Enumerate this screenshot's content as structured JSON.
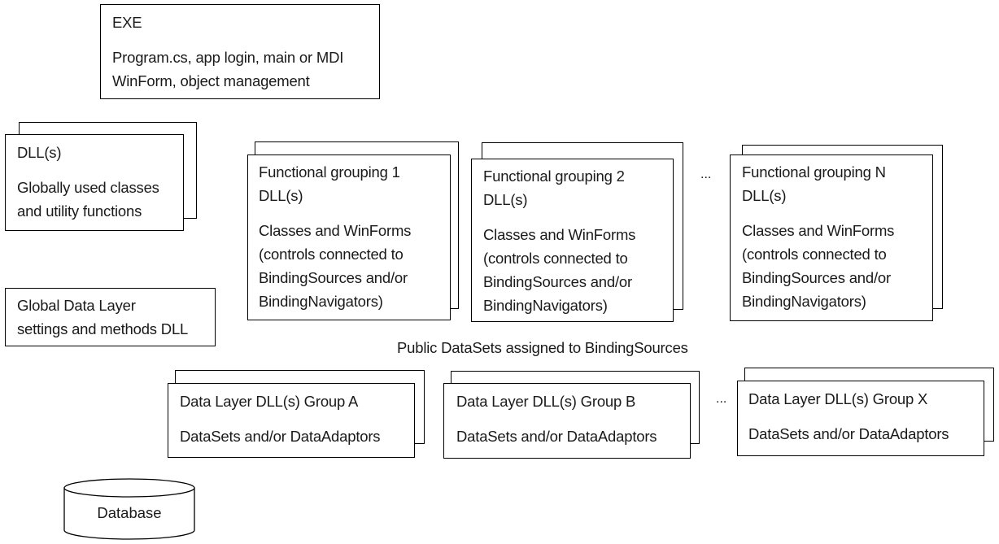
{
  "exe": {
    "title": "EXE",
    "lines": [
      "Program.cs, app login, main or MDI",
      "WinForm, object management"
    ]
  },
  "global_dll": {
    "title": "DLL(s)",
    "lines": [
      "Globally used classes",
      "and utility functions"
    ]
  },
  "global_data_layer": {
    "lines": [
      "Global Data Layer",
      "settings and methods DLL"
    ]
  },
  "functional_groups": [
    {
      "title_lines": [
        "Functional grouping 1",
        "DLL(s)"
      ],
      "lines": [
        "Classes and WinForms",
        "(controls connected to",
        "BindingSources and/or",
        "BindingNavigators)"
      ]
    },
    {
      "title_lines": [
        "Functional grouping 2",
        "DLL(s)"
      ],
      "lines": [
        "Classes and WinForms",
        "(controls connected to",
        "BindingSources and/or",
        "BindingNavigators)"
      ]
    },
    {
      "title_lines": [
        "Functional grouping N",
        "DLL(s)"
      ],
      "lines": [
        "Classes and WinForms",
        "(controls connected to",
        "BindingSources and/or",
        "BindingNavigators)"
      ]
    }
  ],
  "ellipsis": "...",
  "public_datasets_caption": "Public DataSets assigned to BindingSources",
  "data_layers": [
    {
      "title": "Data Layer DLL(s) Group A",
      "line": "DataSets and/or DataAdaptors"
    },
    {
      "title": "Data Layer DLL(s) Group B",
      "line": "DataSets and/or DataAdaptors"
    },
    {
      "title": "Data Layer DLL(s) Group X",
      "line": "DataSets and/or DataAdaptors"
    }
  ],
  "database": {
    "label": "Database"
  }
}
